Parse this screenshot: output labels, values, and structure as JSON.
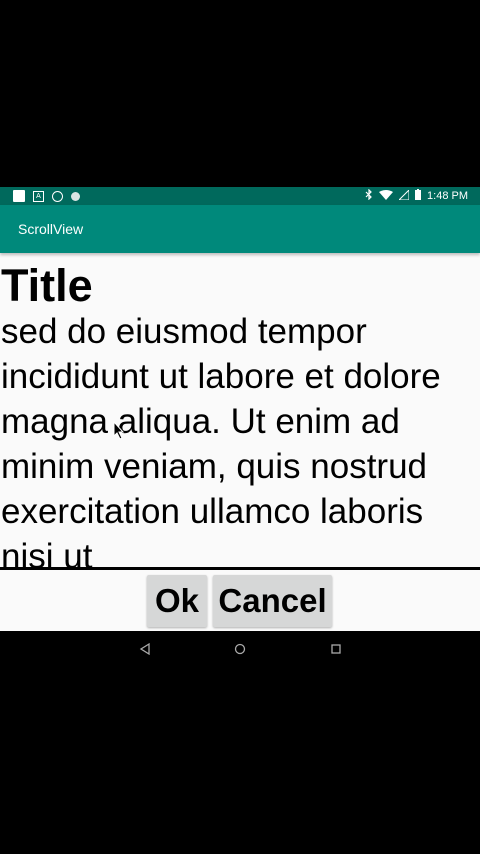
{
  "status_bar": {
    "time": "1:48 PM",
    "left_icons": [
      "notification-square-icon",
      "a-icon",
      "blocked-icon",
      "dot-icon"
    ],
    "right_icons": [
      "bluetooth-icon",
      "wifi-icon",
      "signal-icon",
      "battery-icon"
    ]
  },
  "app_bar": {
    "title": "ScrollView"
  },
  "content": {
    "title": "Title",
    "body": "sed do eiusmod tempor incididunt ut labore et dolore magna aliqua. Ut enim ad minim veniam, quis nostrud exercitation ullamco laboris nisi ut"
  },
  "buttons": {
    "ok": "Ok",
    "cancel": "Cancel"
  },
  "nav_bar": {
    "icons": [
      "back-icon",
      "home-icon",
      "recents-icon"
    ]
  },
  "colors": {
    "status_bar": "#00695c",
    "app_bar": "#00897b",
    "background": "#fafafa",
    "button": "#d6d7d7"
  }
}
